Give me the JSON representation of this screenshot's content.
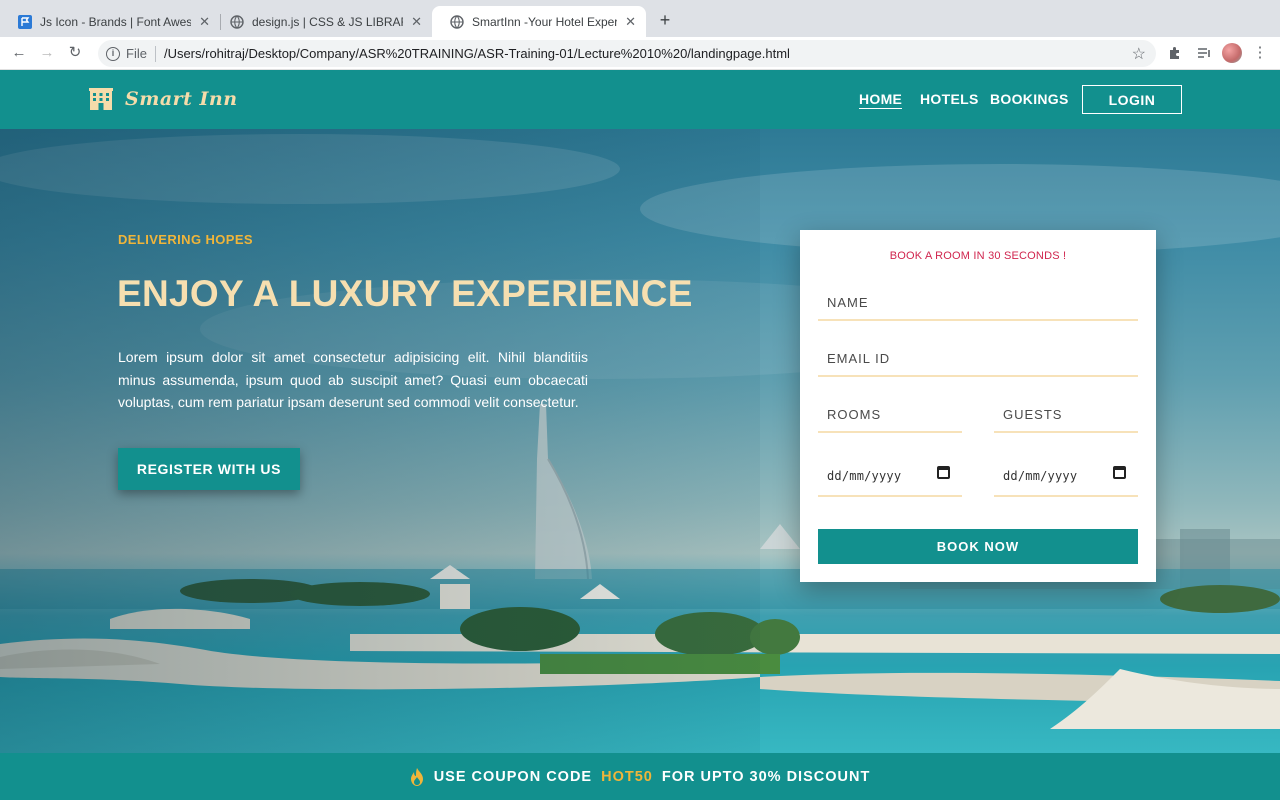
{
  "browser": {
    "tabs": [
      {
        "title": "Js Icon - Brands | Font Awesome",
        "active": false
      },
      {
        "title": "design.js | CSS & JS LIBRARY",
        "active": false
      },
      {
        "title": "SmartInn -Your Hotel Expert",
        "active": true
      }
    ],
    "new_tab": "+",
    "close_glyph": "✕",
    "url_scheme": "File",
    "url": "/Users/rohitraj/Desktop/Company/ASR%20TRAINING/ASR-Training-01/Lecture%2010%20/landingpage.html"
  },
  "header": {
    "logo_text": "Smart Inn",
    "nav": [
      "HOME",
      "HOTELS",
      "BOOKINGS"
    ],
    "login_label": "LOGIN"
  },
  "hero": {
    "kicker": "DELIVERING HOPES",
    "headline": "ENJOY A LUXURY EXPERIENCE",
    "lead": "Lorem ipsum dolor sit amet consectetur adipisicing elit. Nihil blanditiis minus assumenda, ipsum quod ab suscipit amet? Quasi eum obcaecati voluptas, cum rem pariatur ipsam deserunt sed commodi velit consectetur.",
    "register_label": "REGISTER WITH US"
  },
  "booking": {
    "title": "BOOK A ROOM IN 30 SECONDS !",
    "name_placeholder": "NAME",
    "email_placeholder": "EMAIL ID",
    "rooms_placeholder": "ROOMS",
    "guests_placeholder": "GUESTS",
    "checkin_value": "dd/mm/yyyy",
    "checkout_value": "dd/mm/yyyy",
    "book_label": "BOOK NOW"
  },
  "coupon": {
    "prefix": "USE COUPON CODE",
    "code": "HOT50",
    "suffix": "FOR UPTO 30% DISCOUNT"
  },
  "colors": {
    "brand_teal": "#12908e",
    "accent_gold": "#f0b53a",
    "headline_cream": "#f6dfb0",
    "booking_title_red": "#d0254e"
  }
}
